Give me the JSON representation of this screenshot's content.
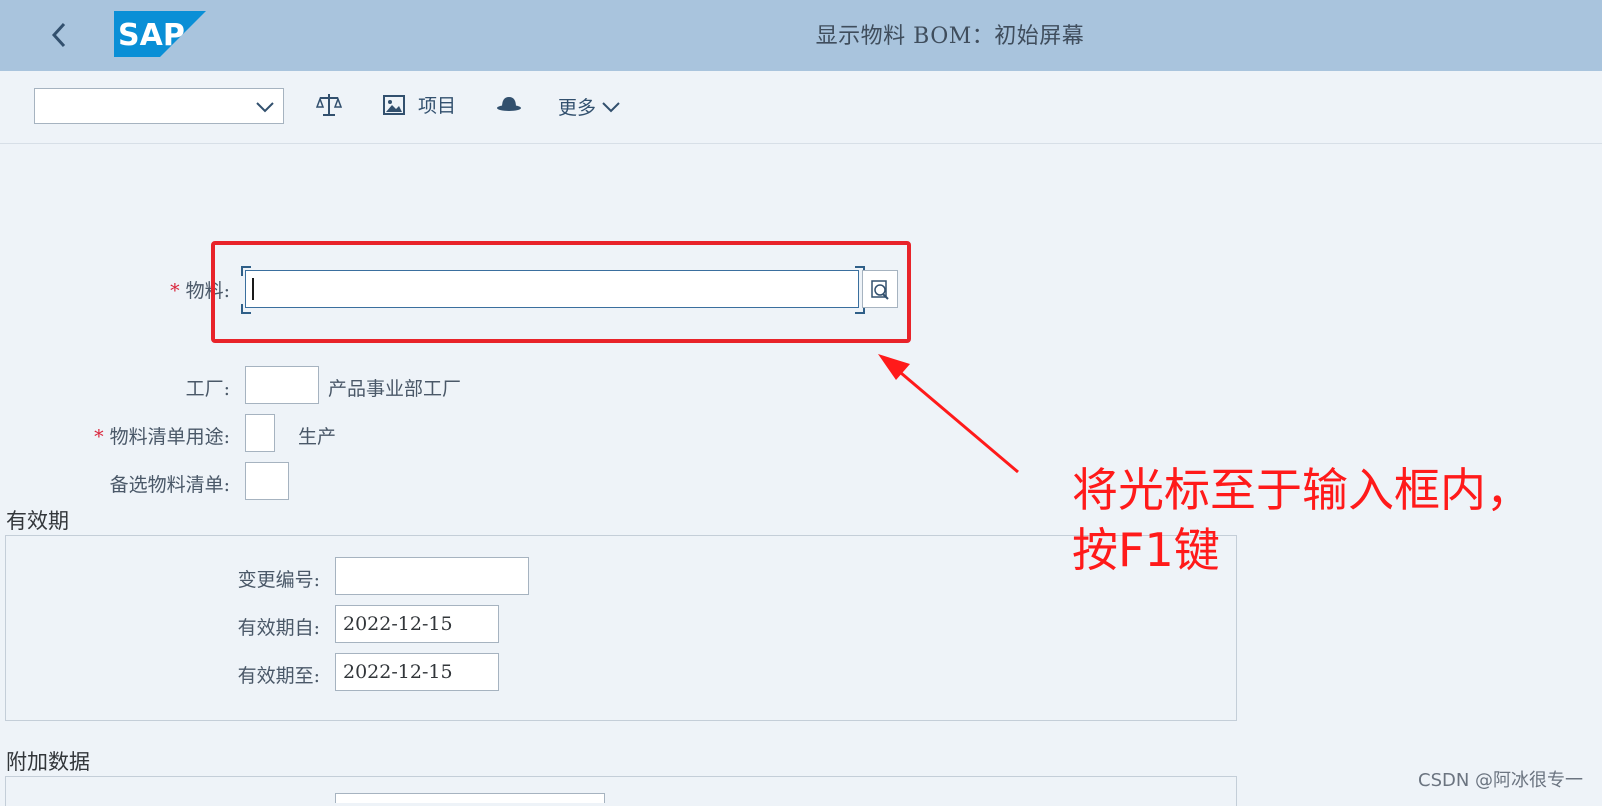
{
  "shell": {
    "title": "显示物料 BOM：初始屏幕",
    "logo_text": "SAP"
  },
  "toolbar": {
    "select_value": "",
    "items_label": "项目",
    "more_label": "更多"
  },
  "form": {
    "material": {
      "label": "物料:",
      "value": ""
    },
    "plant": {
      "label": "工厂:",
      "value": "",
      "desc": "产品事业部工厂"
    },
    "bom_usage": {
      "label": "物料清单用途:",
      "value": "",
      "desc": "生产"
    },
    "alt_bom": {
      "label": "备选物料清单:",
      "value": ""
    }
  },
  "validity": {
    "title": "有效期",
    "change_number": {
      "label": "变更编号:",
      "value": ""
    },
    "valid_from": {
      "label": "有效期自:",
      "value": "2022-12-15"
    },
    "valid_to": {
      "label": "有效期至:",
      "value": "2022-12-15"
    }
  },
  "additional": {
    "title": "附加数据"
  },
  "annotation": {
    "line1": "将光标至于输入框内，",
    "line2": "按F1键"
  },
  "watermark": "CSDN @阿冰很专一",
  "colors": {
    "shell_bg": "#a9c4dd",
    "annotation_red": "#ff1a1a",
    "required_red": "#d9233a"
  }
}
